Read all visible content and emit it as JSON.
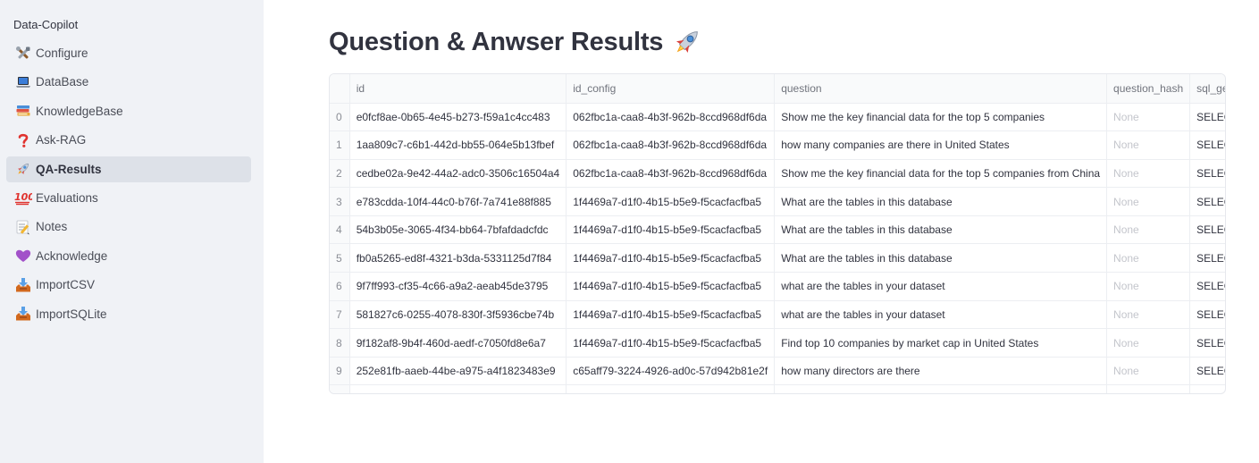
{
  "sidebar": {
    "app_name": "Data-Copilot",
    "items": [
      {
        "label": "Configure",
        "icon": "tools-icon"
      },
      {
        "label": "DataBase",
        "icon": "laptop-icon"
      },
      {
        "label": "KnowledgeBase",
        "icon": "books-icon"
      },
      {
        "label": "Ask-RAG",
        "icon": "question-mark-icon"
      },
      {
        "label": "QA-Results",
        "icon": "rocket-icon",
        "active": true
      },
      {
        "label": "Evaluations",
        "icon": "hundred-points-icon"
      },
      {
        "label": "Notes",
        "icon": "memo-icon"
      },
      {
        "label": "Acknowledge",
        "icon": "purple-heart-icon"
      },
      {
        "label": "ImportCSV",
        "icon": "inbox-tray-icon"
      },
      {
        "label": "ImportSQLite",
        "icon": "inbox-tray-icon"
      }
    ]
  },
  "main": {
    "title": "Question & Anwser Results",
    "title_icon": "rocket-icon"
  },
  "table": {
    "columns": [
      "",
      "id",
      "id_config",
      "question",
      "question_hash",
      "sql_ge"
    ],
    "rows": [
      {
        "index": "0",
        "id": "e0fcf8ae-0b65-4e45-b273-f59a1c4cc483",
        "id_config": "062fbc1a-caa8-4b3f-962b-8ccd968df6da",
        "question": "Show me the key financial data for the top 5 companies",
        "question_hash": "None",
        "sql_generated": "SELEC"
      },
      {
        "index": "1",
        "id": "1aa809c7-c6b1-442d-bb55-064e5b13fbef",
        "id_config": "062fbc1a-caa8-4b3f-962b-8ccd968df6da",
        "question": "how many companies are there in United States",
        "question_hash": "None",
        "sql_generated": "SELEC"
      },
      {
        "index": "2",
        "id": "cedbe02a-9e42-44a2-adc0-3506c16504a4",
        "id_config": "062fbc1a-caa8-4b3f-962b-8ccd968df6da",
        "question": "Show me the key financial data for the top 5 companies from China",
        "question_hash": "None",
        "sql_generated": "SELEC"
      },
      {
        "index": "3",
        "id": "e783cdda-10f4-44c0-b76f-7a741e88f885",
        "id_config": "1f4469a7-d1f0-4b15-b5e9-f5cacfacfba5",
        "question": "What are the tables in this database",
        "question_hash": "None",
        "sql_generated": "SELEC"
      },
      {
        "index": "4",
        "id": "54b3b05e-3065-4f34-bb64-7bfafdadcfdc",
        "id_config": "1f4469a7-d1f0-4b15-b5e9-f5cacfacfba5",
        "question": "What are the tables in this database",
        "question_hash": "None",
        "sql_generated": "SELEC"
      },
      {
        "index": "5",
        "id": "fb0a5265-ed8f-4321-b3da-5331125d7f84",
        "id_config": "1f4469a7-d1f0-4b15-b5e9-f5cacfacfba5",
        "question": "What are the tables in this database",
        "question_hash": "None",
        "sql_generated": "SELEC"
      },
      {
        "index": "6",
        "id": "9f7ff993-cf35-4c66-a9a2-aeab45de3795",
        "id_config": "1f4469a7-d1f0-4b15-b5e9-f5cacfacfba5",
        "question": "what are the tables in your dataset",
        "question_hash": "None",
        "sql_generated": "SELEC"
      },
      {
        "index": "7",
        "id": "581827c6-0255-4078-830f-3f5936cbe74b",
        "id_config": "1f4469a7-d1f0-4b15-b5e9-f5cacfacfba5",
        "question": "what are the tables in your dataset",
        "question_hash": "None",
        "sql_generated": "SELEC"
      },
      {
        "index": "8",
        "id": "9f182af8-9b4f-460d-aedf-c7050fd8e6a7",
        "id_config": "1f4469a7-d1f0-4b15-b5e9-f5cacfacfba5",
        "question": "Find top 10 companies by market cap in United States",
        "question_hash": "None",
        "sql_generated": "SELEC"
      },
      {
        "index": "9",
        "id": "252e81fb-aaeb-44be-a975-a4f1823483e9",
        "id_config": "c65aff79-3224-4926-ad0c-57d942b81e2f",
        "question": "how many directors are there",
        "question_hash": "None",
        "sql_generated": "SELEC"
      }
    ]
  },
  "colors": {
    "sidebar_bg": "#f0f2f6",
    "active_item_bg": "#dde1e8",
    "text": "#31333f",
    "muted": "#c4c6cc"
  }
}
